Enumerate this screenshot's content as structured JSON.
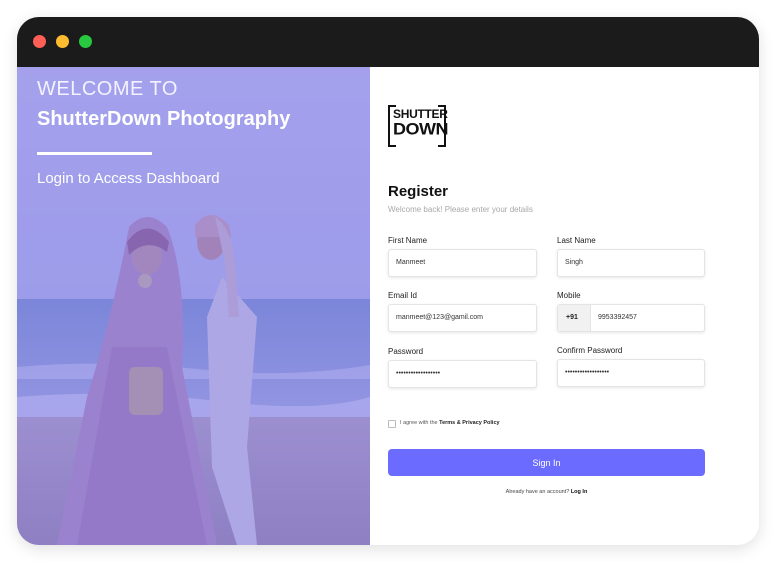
{
  "window": {
    "controls": [
      "close",
      "minimize",
      "maximize"
    ]
  },
  "hero": {
    "welcome": "WELCOME TO",
    "brand": "ShutterDown Photography",
    "subtitle": "Login to Access Dashboard",
    "overlay_color": "#8d86ee"
  },
  "logo": {
    "line1": "SHUTTER",
    "line2": "DOWN"
  },
  "form": {
    "title": "Register",
    "subtitle": "Welcome back! Please enter your details",
    "first_name": {
      "label": "First Name",
      "value": "Manmeet"
    },
    "last_name": {
      "label": "Last Name",
      "value": "Singh"
    },
    "email": {
      "label": "Email Id",
      "value": "manmeet@123@gamil.com"
    },
    "mobile": {
      "label": "Mobile",
      "country_code": "+91",
      "value": "9953392457"
    },
    "password": {
      "label": "Password",
      "value": "••••••••••••••••••"
    },
    "confirm_password": {
      "label": "Confirm Password",
      "value": "••••••••••••••••••"
    },
    "agree_prefix": "I agree with the",
    "agree_link": "Terms & Privacy Policy",
    "submit_label": "Sign In",
    "already_text": "Already have an account?",
    "login_link": "Log In"
  },
  "colors": {
    "accent": "#6b6cff",
    "titlebar": "#1b1b1b"
  }
}
